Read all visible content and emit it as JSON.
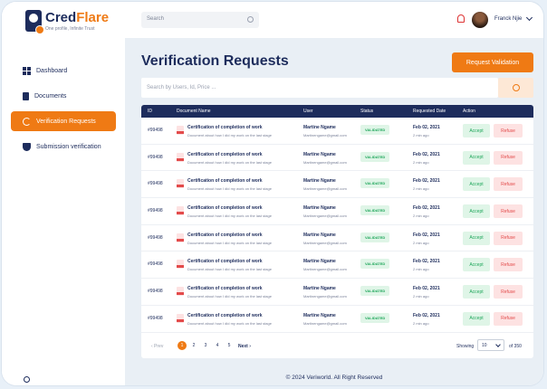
{
  "brand": {
    "name_first": "Cred",
    "name_second": "Flare",
    "tagline": "One profile, Infinite Trust"
  },
  "colors": {
    "primary": "#1d2c5c",
    "accent": "#ef7a14",
    "success": "#1ea65a",
    "danger": "#e34b4b"
  },
  "sidebar": {
    "items": [
      {
        "label": "Dashboard",
        "icon": "grid-icon"
      },
      {
        "label": "Documents",
        "icon": "document-icon"
      },
      {
        "label": "Verification Requests",
        "icon": "loading-ring-icon"
      },
      {
        "label": "Submission verification",
        "icon": "shield-check-icon"
      }
    ]
  },
  "topbar": {
    "search_placeholder": "Search",
    "user_name": "Franck Njie"
  },
  "page": {
    "title": "Verification Requests",
    "request_button": "Request Validation",
    "table_search_placeholder": "Search by Users, Id, Price ..."
  },
  "table": {
    "headers": [
      "ID",
      "Document Name",
      "User",
      "Status",
      "Requested Date",
      "Action"
    ],
    "rows": [
      {
        "id": "#99498",
        "doc_title": "Certification of completion of work",
        "doc_desc": "Document about how I did my work on the last stage",
        "user_name": "Martine Ngame",
        "user_email": "Martinengame@gmail.com",
        "status": "VALIDATED",
        "date": "Feb 02, 2021",
        "ago": "2 min ago",
        "accept": "Accept",
        "refuse": "Refuse"
      },
      {
        "id": "#99498",
        "doc_title": "Certification of completion of work",
        "doc_desc": "Document about how I did my work on the last stage",
        "user_name": "Martine Ngame",
        "user_email": "Martinengame@gmail.com",
        "status": "VALIDATED",
        "date": "Feb 02, 2021",
        "ago": "2 min ago",
        "accept": "Accept",
        "refuse": "Refuse"
      },
      {
        "id": "#99498",
        "doc_title": "Certification of completion of work",
        "doc_desc": "Document about how I did my work on the last stage",
        "user_name": "Martine Ngame",
        "user_email": "Martinengame@gmail.com",
        "status": "VALIDATED",
        "date": "Feb 02, 2021",
        "ago": "2 min ago",
        "accept": "Accept",
        "refuse": "Refuse"
      },
      {
        "id": "#99498",
        "doc_title": "Certification of completion of work",
        "doc_desc": "Document about how I did my work on the last stage",
        "user_name": "Martine Ngame",
        "user_email": "Martinengame@gmail.com",
        "status": "VALIDATED",
        "date": "Feb 02, 2021",
        "ago": "2 min ago",
        "accept": "Accept",
        "refuse": "Refuse"
      },
      {
        "id": "#99498",
        "doc_title": "Certification of completion of work",
        "doc_desc": "Document about how I did my work on the last stage",
        "user_name": "Martine Ngame",
        "user_email": "Martinengame@gmail.com",
        "status": "VALIDATED",
        "date": "Feb 02, 2021",
        "ago": "2 min ago",
        "accept": "Accept",
        "refuse": "Refuse"
      },
      {
        "id": "#99498",
        "doc_title": "Certification of completion of work",
        "doc_desc": "Document about how I did my work on the last stage",
        "user_name": "Martine Ngame",
        "user_email": "Martinengame@gmail.com",
        "status": "VALIDATED",
        "date": "Feb 02, 2021",
        "ago": "2 min ago",
        "accept": "Accept",
        "refuse": "Refuse"
      },
      {
        "id": "#99498",
        "doc_title": "Certification of completion of work",
        "doc_desc": "Document about how I did my work on the last stage",
        "user_name": "Martine Ngame",
        "user_email": "Martinengame@gmail.com",
        "status": "VALIDATED",
        "date": "Feb 02, 2021",
        "ago": "2 min ago",
        "accept": "Accept",
        "refuse": "Refuse"
      },
      {
        "id": "#99498",
        "doc_title": "Certification of completion of work",
        "doc_desc": "Document about how I did my work on the last stage",
        "user_name": "Martine Ngame",
        "user_email": "Martinengame@gmail.com",
        "status": "VALIDATED",
        "date": "Feb 02, 2021",
        "ago": "2 min ago",
        "accept": "Accept",
        "refuse": "Refuse"
      }
    ]
  },
  "pagination": {
    "prev": "‹ Prev",
    "pages": [
      "1",
      "2",
      "3",
      "4",
      "5"
    ],
    "active_page": "1",
    "next": "Next ›",
    "showing": "Showing",
    "per_page": "10",
    "of_total": "of 350"
  },
  "footer": {
    "text": "© 2024 Veriworld. All Right Reserved"
  }
}
